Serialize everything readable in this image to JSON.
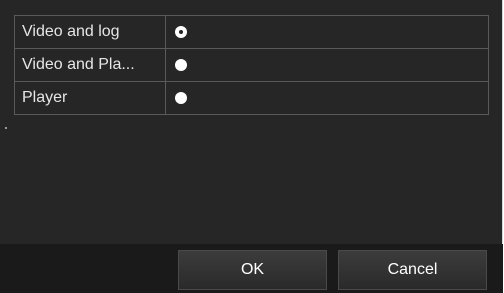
{
  "options": [
    {
      "label": "Video and log",
      "selected": true
    },
    {
      "label": "Video and Pla...",
      "selected": false
    },
    {
      "label": "Player",
      "selected": false
    }
  ],
  "buttons": {
    "ok_label": "OK",
    "cancel_label": "Cancel"
  },
  "colors": {
    "background": "#262626",
    "footer": "#1a1a1a",
    "radio": "#ffffff",
    "grid_line": "#5a5a5a"
  }
}
